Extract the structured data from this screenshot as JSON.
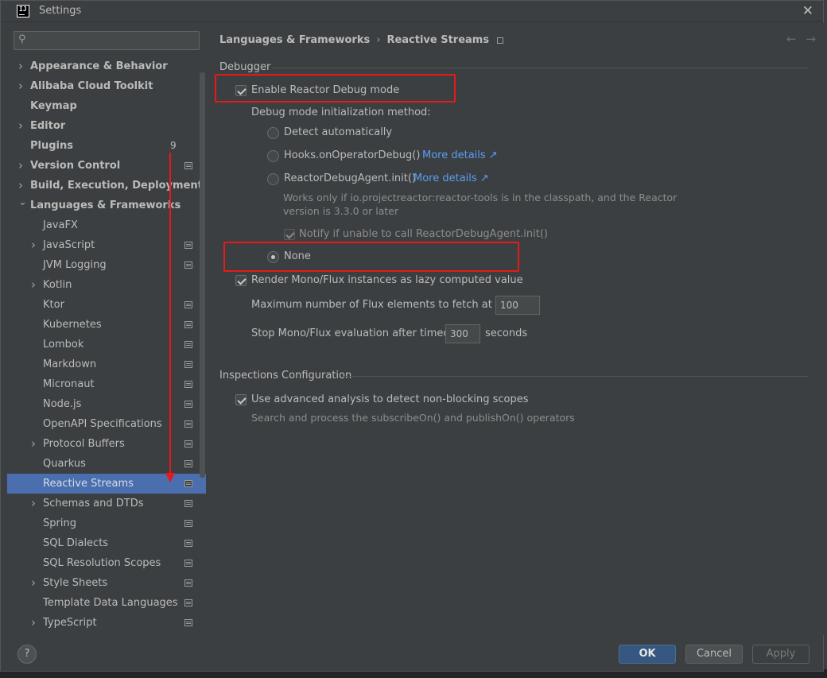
{
  "window": {
    "title": "Settings",
    "app_icon": "intellij-icon",
    "app_icon_text": "IJ"
  },
  "search": {
    "placeholder": "",
    "value": ""
  },
  "tree": {
    "items": [
      {
        "label": "Appearance & Behavior",
        "level": 0,
        "chevron": "right"
      },
      {
        "label": "Alibaba Cloud Toolkit",
        "level": 0,
        "chevron": "right"
      },
      {
        "label": "Keymap",
        "level": 0,
        "chevron": ""
      },
      {
        "label": "Editor",
        "level": 0,
        "chevron": "right"
      },
      {
        "label": "Plugins",
        "level": 0,
        "chevron": "",
        "badge": "9"
      },
      {
        "label": "Version Control",
        "level": 0,
        "chevron": "right",
        "proj": true
      },
      {
        "label": "Build, Execution, Deployment",
        "level": 0,
        "chevron": "right"
      },
      {
        "label": "Languages & Frameworks",
        "level": 0,
        "chevron": "down"
      },
      {
        "label": "JavaFX",
        "level": 1,
        "chevron": ""
      },
      {
        "label": "JavaScript",
        "level": 1,
        "chevron": "right",
        "proj": true
      },
      {
        "label": "JVM Logging",
        "level": 1,
        "chevron": "",
        "proj": true
      },
      {
        "label": "Kotlin",
        "level": 1,
        "chevron": "right"
      },
      {
        "label": "Ktor",
        "level": 1,
        "chevron": "",
        "proj": true
      },
      {
        "label": "Kubernetes",
        "level": 1,
        "chevron": "",
        "proj": true
      },
      {
        "label": "Lombok",
        "level": 1,
        "chevron": "",
        "proj": true
      },
      {
        "label": "Markdown",
        "level": 1,
        "chevron": "",
        "proj": true
      },
      {
        "label": "Micronaut",
        "level": 1,
        "chevron": "",
        "proj": true
      },
      {
        "label": "Node.js",
        "level": 1,
        "chevron": "",
        "proj": true
      },
      {
        "label": "OpenAPI Specifications",
        "level": 1,
        "chevron": "",
        "proj": true
      },
      {
        "label": "Protocol Buffers",
        "level": 1,
        "chevron": "right",
        "proj": true
      },
      {
        "label": "Quarkus",
        "level": 1,
        "chevron": "",
        "proj": true
      },
      {
        "label": "Reactive Streams",
        "level": 1,
        "chevron": "",
        "proj": true,
        "selected": true
      },
      {
        "label": "Schemas and DTDs",
        "level": 1,
        "chevron": "right",
        "proj": true
      },
      {
        "label": "Spring",
        "level": 1,
        "chevron": "",
        "proj": true
      },
      {
        "label": "SQL Dialects",
        "level": 1,
        "chevron": "",
        "proj": true
      },
      {
        "label": "SQL Resolution Scopes",
        "level": 1,
        "chevron": "",
        "proj": true
      },
      {
        "label": "Style Sheets",
        "level": 1,
        "chevron": "right",
        "proj": true
      },
      {
        "label": "Template Data Languages",
        "level": 1,
        "chevron": "",
        "proj": true
      },
      {
        "label": "TypeScript",
        "level": 1,
        "chevron": "right",
        "proj": true
      }
    ]
  },
  "breadcrumb": {
    "parent": "Languages & Frameworks",
    "separator": "›",
    "current": "Reactive Streams"
  },
  "nav": {
    "back": "←",
    "forward": "→"
  },
  "debugger": {
    "section_title": "Debugger",
    "enable_label": "Enable Reactor Debug mode",
    "enable_checked": true,
    "method_label": "Debug mode initialization method:",
    "opt_detect": "Detect automatically",
    "opt_hooks": "Hooks.onOperatorDebug()",
    "opt_agent": "ReactorDebugAgent.init()",
    "more_details": "More details ↗",
    "agent_hint_1": "Works only if io.projectreactor:reactor-tools is in the classpath, and the Reactor",
    "agent_hint_2": "version is 3.3.0 or later",
    "notify_label": "Notify if unable to call ReactorDebugAgent.init()",
    "opt_none": "None",
    "selected_method": "None",
    "render_label": "Render Mono/Flux instances as lazy computed value",
    "render_checked": true,
    "max_flux_label": "Maximum number of Flux elements to fetch at once:",
    "max_flux_value": "100",
    "timeout_label": "Stop Mono/Flux evaluation after timeout:",
    "timeout_value": "300",
    "timeout_unit": "seconds"
  },
  "inspections": {
    "section_title": "Inspections Configuration",
    "advanced_label": "Use advanced analysis to detect non-blocking scopes",
    "advanced_checked": true,
    "advanced_hint": "Search and process the subscribeOn() and publishOn() operators"
  },
  "footer": {
    "help": "?",
    "ok": "OK",
    "cancel": "Cancel",
    "apply": "Apply"
  },
  "colors": {
    "annotation": "#e81919",
    "selection": "#4b6eaf",
    "link": "#589df6",
    "background": "#3c3f41"
  }
}
